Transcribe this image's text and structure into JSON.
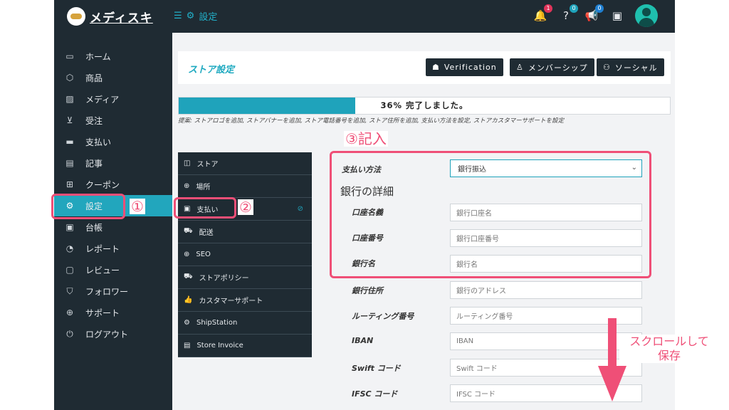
{
  "app": {
    "brand": "メディスキ",
    "breadcrumb": "設定",
    "menu_icon": "hamburger-icon",
    "settings_icon": "gears-icon"
  },
  "topbar": {
    "notifications_badge": "1",
    "help_badge": "0",
    "announce_badge": "0"
  },
  "sidebar": {
    "items": [
      {
        "label": "ホーム",
        "icon": "monitor-icon"
      },
      {
        "label": "商品",
        "icon": "cube-icon"
      },
      {
        "label": "メディア",
        "icon": "image-icon"
      },
      {
        "label": "受注",
        "icon": "cart-icon"
      },
      {
        "label": "支払い",
        "icon": "card-icon"
      },
      {
        "label": "記事",
        "icon": "document-icon"
      },
      {
        "label": "クーポン",
        "icon": "gift-icon"
      },
      {
        "label": "設定",
        "icon": "gears-icon"
      },
      {
        "label": "台帳",
        "icon": "money-icon"
      },
      {
        "label": "レポート",
        "icon": "chart-icon"
      },
      {
        "label": "レビュー",
        "icon": "comment-icon"
      },
      {
        "label": "フォロワー",
        "icon": "shirt-icon"
      },
      {
        "label": "サポート",
        "icon": "globe-icon"
      },
      {
        "label": "ログアウト",
        "icon": "power-icon"
      }
    ]
  },
  "header": {
    "title": "ストア設定",
    "buttons": [
      {
        "label": "Verification",
        "icon": "medal-icon"
      },
      {
        "label": "メンバーシップ",
        "icon": "user-plus-icon"
      },
      {
        "label": "ソーシャル",
        "icon": "users-icon"
      }
    ]
  },
  "progress": {
    "percent": 36,
    "text": "36% 完了しました。",
    "suggestion": "提案: ストアロゴを追加, ストアバナーを追加, ストア電話番号を追加, ストア住所を追加, 支払い方法を設定, ストアカスタマーサポートを設定"
  },
  "submenu": {
    "items": [
      {
        "label": "ストア",
        "icon": "bag-icon"
      },
      {
        "label": "場所",
        "icon": "globe-icon"
      },
      {
        "label": "支払い",
        "icon": "money-icon"
      },
      {
        "label": "配送",
        "icon": "truck-icon"
      },
      {
        "label": "SEO",
        "icon": "globe-icon"
      },
      {
        "label": "ストアポリシー",
        "icon": "truck-icon"
      },
      {
        "label": "カスタマーサポート",
        "icon": "thumbs-up-icon"
      },
      {
        "label": "ShipStation",
        "icon": "gear-icon"
      },
      {
        "label": "Store Invoice",
        "icon": "file-icon"
      }
    ]
  },
  "form": {
    "payment_method_label": "支払い方法",
    "payment_method_value": "銀行振込",
    "bank_details_heading": "銀行の詳細",
    "fields": [
      {
        "label": "口座名義",
        "placeholder": "銀行口座名"
      },
      {
        "label": "口座番号",
        "placeholder": "銀行口座番号"
      },
      {
        "label": "銀行名",
        "placeholder": "銀行名"
      },
      {
        "label": "銀行住所",
        "placeholder": "銀行のアドレス"
      },
      {
        "label": "ルーティング番号",
        "placeholder": "ルーティング番号"
      },
      {
        "label": "IBAN",
        "placeholder": "IBAN"
      },
      {
        "label": "Swift コード",
        "placeholder": "Swift コード"
      },
      {
        "label": "IFSC コード",
        "placeholder": "IFSC コード"
      }
    ]
  },
  "annotations": {
    "step1": "①",
    "step2": "②",
    "step3": "③記入",
    "scroll_note_line1": "スクロールして",
    "scroll_note_line2": "保存",
    "accent": "#ef4f77"
  }
}
